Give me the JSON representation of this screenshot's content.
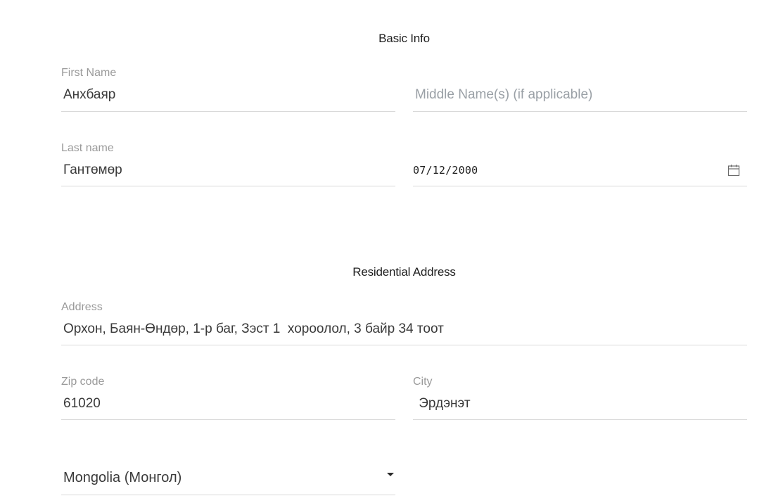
{
  "basic_info": {
    "title": "Basic Info",
    "first_name": {
      "label": "First Name",
      "value": "Анхбаяр"
    },
    "middle_name": {
      "placeholder": "Middle Name(s) (if applicable)",
      "value": ""
    },
    "last_name": {
      "label": "Last name",
      "value": "Гантөмөр"
    },
    "birth_date": {
      "value": "07/12/2000",
      "icon": "calendar-icon"
    }
  },
  "residential_address": {
    "title": "Residential Address",
    "address": {
      "label": "Address",
      "value": "Орхон, Баян-Өндөр, 1-р баг, Зэст 1  хороолол, 3 байр 34 тоот"
    },
    "zip_code": {
      "label": "Zip code",
      "value": "61020"
    },
    "city": {
      "label": "City",
      "value": " Эрдэнэт"
    },
    "country": {
      "value": "Mongolia (Монгол)",
      "icon": "caret-down-icon"
    }
  }
}
